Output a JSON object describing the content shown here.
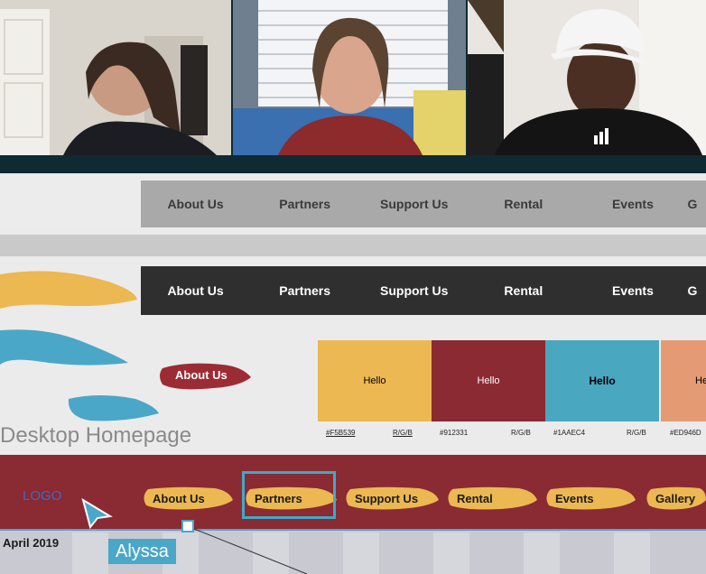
{
  "video": {
    "participants": [
      {
        "id": "p1"
      },
      {
        "id": "p2"
      },
      {
        "id": "p3"
      }
    ]
  },
  "nav_gray": {
    "items": [
      "About Us",
      "Partners",
      "Support Us",
      "Rental",
      "Events",
      "G"
    ]
  },
  "nav_dark": {
    "items": [
      "About Us",
      "Partners",
      "Support Us",
      "Rental",
      "Events",
      "G"
    ]
  },
  "about_button": {
    "label": "About Us"
  },
  "swatches": [
    {
      "label": "Hello",
      "hex": "#F5B539",
      "rgb": "R/G/B",
      "color": "#ecb852"
    },
    {
      "label": "Hello",
      "hex": "#912331",
      "rgb": "R/G/B",
      "color": "#8c2a33"
    },
    {
      "label": "Hello",
      "hex": "#1AAEC4",
      "rgb": "R/G/B",
      "color": "#4aa7c0"
    },
    {
      "label": "He",
      "hex": "#ED946D",
      "rgb": "",
      "color": "#e49b74"
    }
  ],
  "section_title": "Desktop Homepage",
  "header": {
    "logo": "LOGO",
    "nav_items": [
      "About Us",
      "Partners",
      "Support Us",
      "Rental",
      "Events",
      "Gallery"
    ],
    "background": "#8a2a33"
  },
  "calendar": {
    "date_label": "April 2019"
  },
  "cursor": {
    "user": "Alyssa"
  }
}
